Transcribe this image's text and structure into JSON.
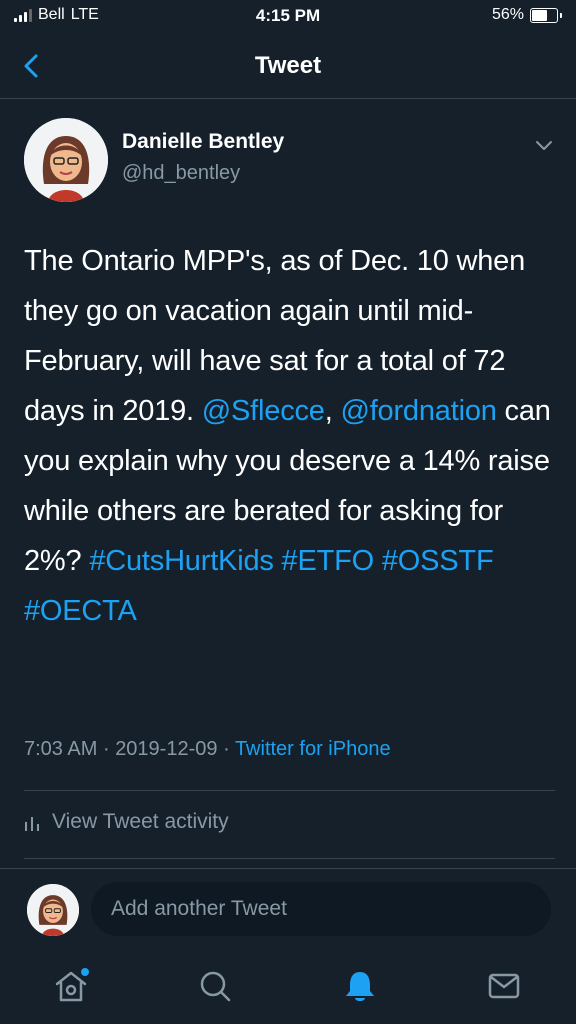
{
  "status_bar": {
    "carrier": "Bell",
    "network": "LTE",
    "time": "4:15 PM",
    "battery": "56%",
    "battery_level": 0.56
  },
  "nav": {
    "title": "Tweet"
  },
  "author": {
    "name": "Danielle Bentley",
    "handle": "@hd_bentley"
  },
  "tweet": {
    "text_1": "The Ontario MPP's, as of Dec. 10 when they go on vacation again until mid- February, will have sat for a total of 72 days in 2019.",
    "mention_1": "@Sflecce",
    "comma": ",",
    "mention_2": "@fordnation",
    "text_2": "can you explain why you deserve a 14% raise while others are berated for asking for 2%?",
    "hashtags": [
      "#CutsHurtKids",
      "#ETFO",
      "#OSSTF",
      "#OECTA"
    ]
  },
  "meta": {
    "time": "7:03 AM",
    "dot": "·",
    "date": "2019-12-09",
    "source": "Twitter for iPhone"
  },
  "activity": {
    "label": "View Tweet activity"
  },
  "composer": {
    "placeholder": "Add another Tweet"
  },
  "colors": {
    "background": "#15202b",
    "accent": "#1da1f2",
    "secondary_text": "#8899a6",
    "divider": "#38444d"
  },
  "tabbar": {
    "icons": [
      "home-icon",
      "search-icon",
      "notifications-icon",
      "messages-icon"
    ],
    "active": "notifications-icon"
  }
}
